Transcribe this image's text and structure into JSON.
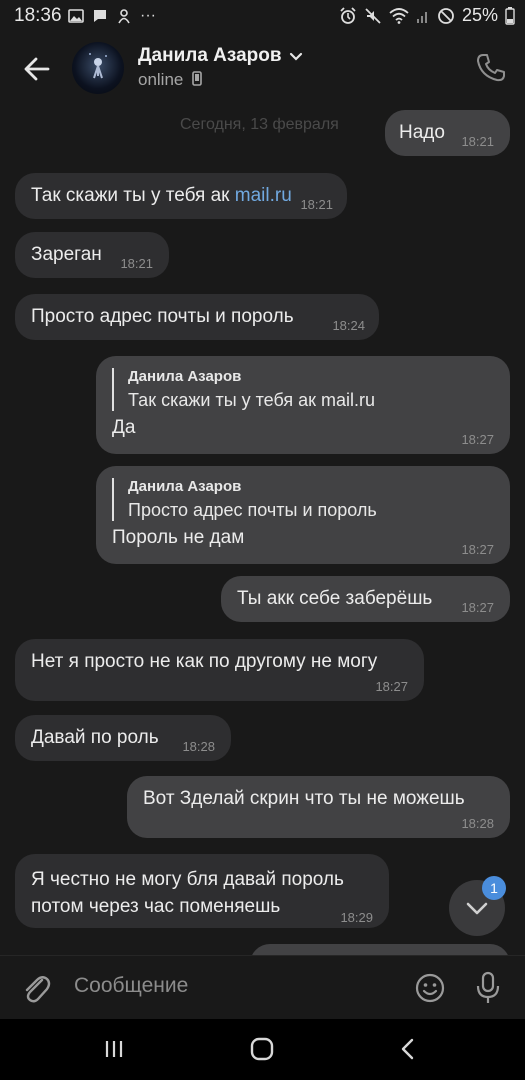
{
  "status_bar": {
    "time": "18:36",
    "more": "···",
    "battery": "25%"
  },
  "header": {
    "name": "Данила Азаров",
    "status": "online"
  },
  "chat": {
    "date": "Сегодня, 13 февраля",
    "messages": [
      {
        "dir": "out",
        "text": "Надо",
        "time": "18:21"
      },
      {
        "dir": "in",
        "text": "Так скажи ты у тебя ак ",
        "link": "mail.ru",
        "time": "18:21"
      },
      {
        "dir": "in",
        "text": "Зареган",
        "time": "18:21"
      },
      {
        "dir": "in",
        "text": "Просто адрес почты и пороль",
        "time": "18:24"
      },
      {
        "dir": "out",
        "reply_name": "Данила Азаров",
        "reply_text": "Так скажи ты у тебя ак mail.ru",
        "text": "Да",
        "time": "18:27"
      },
      {
        "dir": "out",
        "reply_name": "Данила Азаров",
        "reply_text": "Просто адрес почты и пороль",
        "text": "Пороль не дам",
        "time": "18:27"
      },
      {
        "dir": "out",
        "text": "Ты акк себе заберёшь",
        "time": "18:27"
      },
      {
        "dir": "in",
        "text": "Нет я просто не как по другому не могу",
        "time": "18:27"
      },
      {
        "dir": "in",
        "text": "Давай по роль",
        "time": "18:28"
      },
      {
        "dir": "out",
        "text": "Вот Зделай скрин что ты не можешь",
        "time": "18:28"
      },
      {
        "dir": "in",
        "line1": "Я честно не могу бля  давай пороль",
        "line2": "потом через час поменяешь",
        "time": "18:29"
      }
    ],
    "unread_count": "1"
  },
  "composer": {
    "placeholder": "Сообщение"
  }
}
